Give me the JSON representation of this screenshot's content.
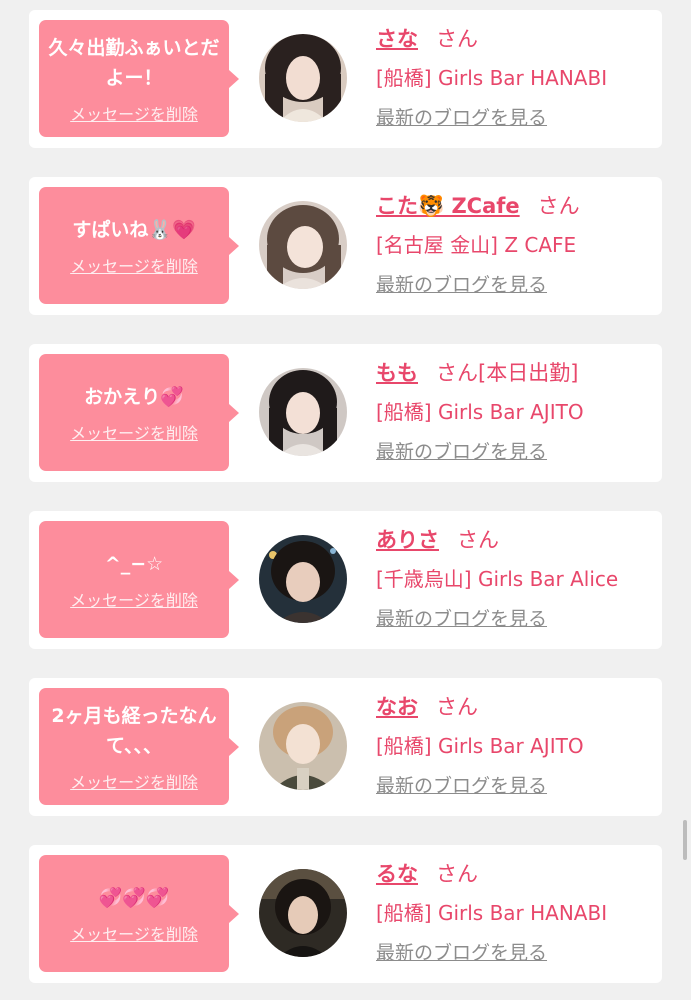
{
  "colors": {
    "bubble": "#fd8d9c",
    "accent": "#e8476b",
    "link_gray": "#8c8c8c",
    "page_bg": "#f0f0f0"
  },
  "entries": [
    {
      "message": "久々出勤ふぁいとだよー！",
      "delete_label": "メッセージを削除",
      "name": "さな",
      "honorific": "さん",
      "status": "",
      "shop": "[船橋] Girls Bar HANABI",
      "blog_label": "最新のブログを見る",
      "avatar_icon": "avatar-photo"
    },
    {
      "message": "すぱいね🐰💗",
      "delete_label": "メッセージを削除",
      "name": "こた🐯 ZCafe",
      "honorific": "さん",
      "status": "",
      "shop": "[名古屋 金山] Z CAFE",
      "blog_label": "最新のブログを見る",
      "avatar_icon": "avatar-photo"
    },
    {
      "message": "おかえり💞",
      "delete_label": "メッセージを削除",
      "name": "もも",
      "honorific": "さん",
      "status": "[本日出勤]",
      "shop": "[船橋] Girls Bar AJITO",
      "blog_label": "最新のブログを見る",
      "avatar_icon": "avatar-photo"
    },
    {
      "message": "^_−☆",
      "delete_label": "メッセージを削除",
      "name": "ありさ",
      "honorific": "さん",
      "status": "",
      "shop": "[千歳烏山] Girls Bar Alice",
      "blog_label": "最新のブログを見る",
      "avatar_icon": "avatar-photo"
    },
    {
      "message": "2ヶ月も経ったなんて、、、",
      "delete_label": "メッセージを削除",
      "name": "なお",
      "honorific": "さん",
      "status": "",
      "shop": "[船橋] Girls Bar AJITO",
      "blog_label": "最新のブログを見る",
      "avatar_icon": "avatar-photo"
    },
    {
      "message": "💞💞💞",
      "delete_label": "メッセージを削除",
      "name": "るな",
      "honorific": "さん",
      "status": "",
      "shop": "[船橋] Girls Bar HANABI",
      "blog_label": "最新のブログを見る",
      "avatar_icon": "avatar-photo"
    }
  ]
}
